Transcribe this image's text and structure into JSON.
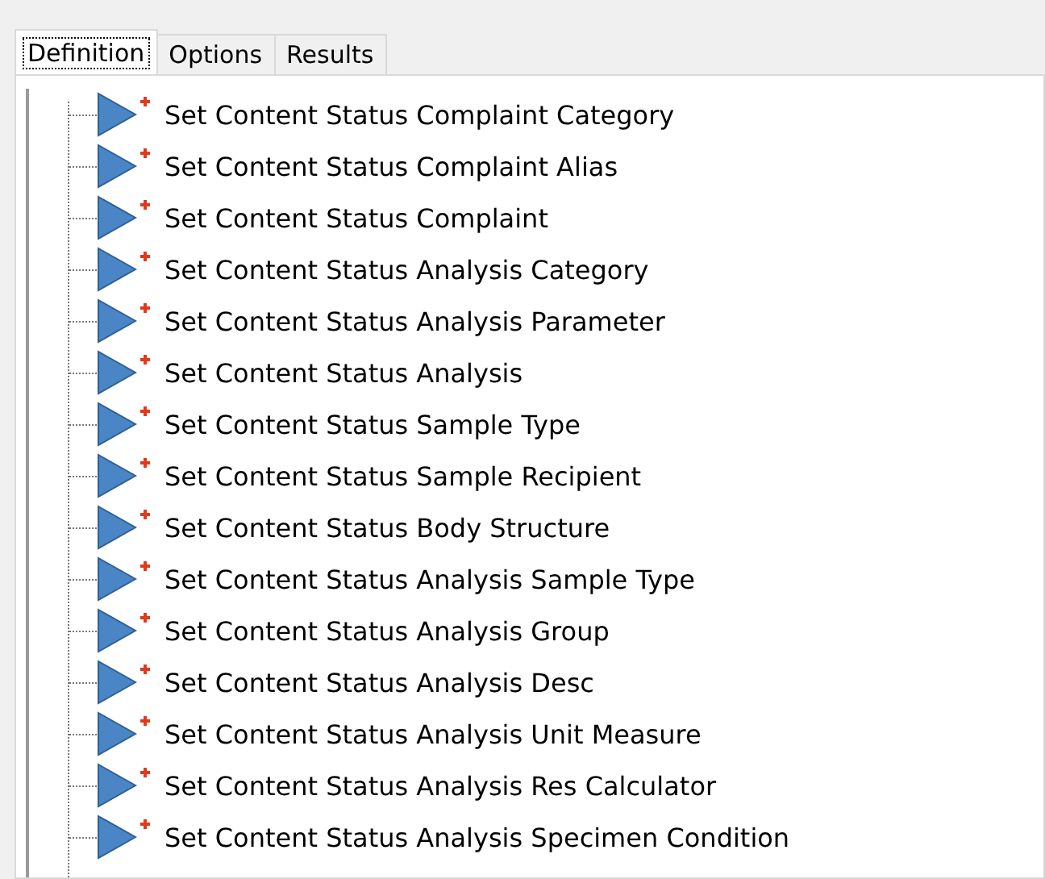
{
  "tabs": [
    {
      "label": "Definition",
      "selected": true
    },
    {
      "label": "Options",
      "selected": false
    },
    {
      "label": "Results",
      "selected": false
    }
  ],
  "tree": {
    "items": [
      {
        "label": "Set Content Status Complaint Category"
      },
      {
        "label": "Set Content Status Complaint Alias"
      },
      {
        "label": "Set Content Status Complaint"
      },
      {
        "label": "Set Content Status Analysis Category"
      },
      {
        "label": "Set Content Status Analysis Parameter"
      },
      {
        "label": "Set Content Status Analysis"
      },
      {
        "label": "Set Content Status Sample Type"
      },
      {
        "label": "Set Content Status Sample Recipient"
      },
      {
        "label": "Set Content Status Body Structure"
      },
      {
        "label": "Set Content Status Analysis Sample Type"
      },
      {
        "label": "Set Content Status Analysis Group"
      },
      {
        "label": "Set Content Status Analysis Desc"
      },
      {
        "label": "Set Content Status Analysis Unit Measure"
      },
      {
        "label": "Set Content Status Analysis Res Calculator"
      },
      {
        "label": "Set Content Status Analysis Specimen Condition"
      }
    ]
  }
}
